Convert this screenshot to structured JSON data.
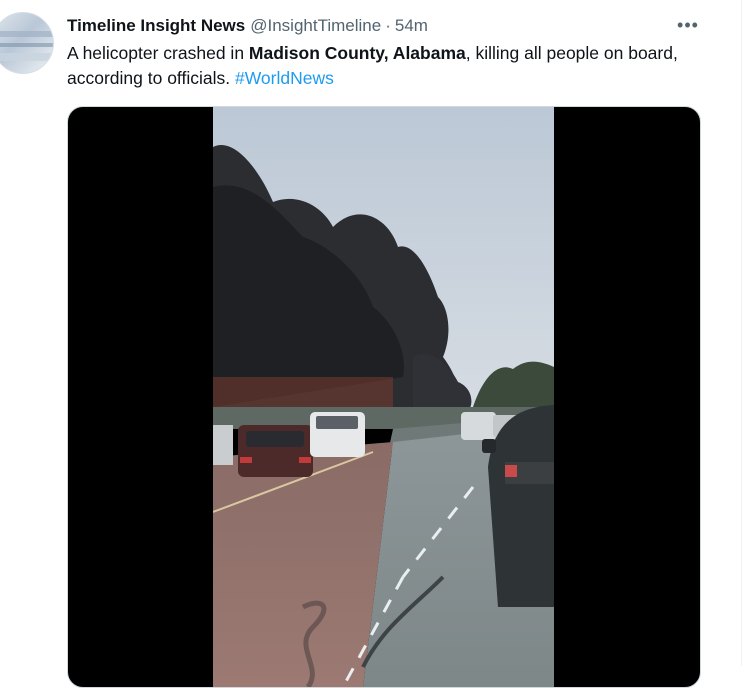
{
  "author": {
    "display_name": "Timeline Insight News",
    "handle": "@InsightTimeline",
    "separator": "·",
    "time": "54m"
  },
  "more_glyph": "•••",
  "tweet": {
    "text_part1": "A helicopter crashed in ",
    "text_bold": "Madison County, Alabama",
    "text_part2": ", killing all people on board, according to officials. ",
    "hashtag": "#WorldNews"
  },
  "icons": [
    "more-horizontal-icon"
  ],
  "colors": {
    "accent": "#1d9bf0",
    "text": "#0f1419",
    "secondary_text": "#536471",
    "media_background": "#000000"
  }
}
